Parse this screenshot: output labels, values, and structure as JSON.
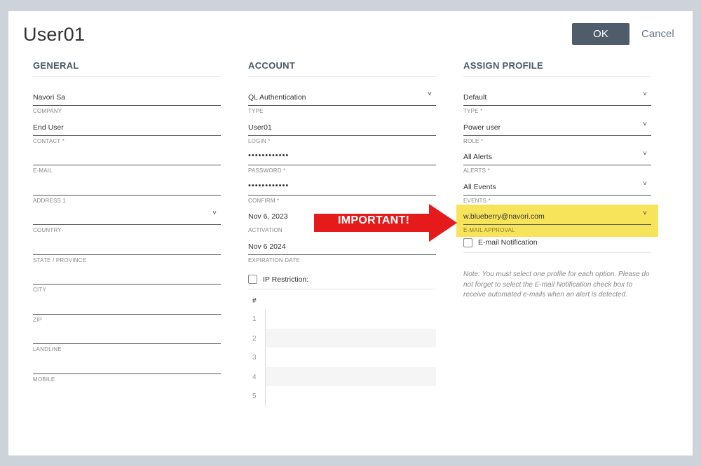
{
  "dialog": {
    "title": "User01",
    "ok_label": "OK",
    "cancel_label": "Cancel"
  },
  "general": {
    "heading": "GENERAL",
    "fields": [
      {
        "value": "Navori Sa",
        "label": "COMPANY"
      },
      {
        "value": "End User",
        "label": "CONTACT *"
      },
      {
        "value": "",
        "label": "E-MAIL"
      },
      {
        "value": "",
        "label": "ADDRESS 1"
      },
      {
        "value": "",
        "label": "COUNTRY"
      },
      {
        "value": "",
        "label": "STATE / PROVINCE"
      },
      {
        "value": "",
        "label": "CITY"
      },
      {
        "value": "",
        "label": "ZIP"
      },
      {
        "value": "",
        "label": "LANDLINE"
      },
      {
        "value": "",
        "label": "MOBILE"
      }
    ]
  },
  "account": {
    "heading": "ACCOUNT",
    "fields": [
      {
        "value": "QL Authentication",
        "label": "TYPE"
      },
      {
        "value": "User01",
        "label": "LOGIN *"
      },
      {
        "value": "••••••••••••",
        "label": "PASSWORD *"
      },
      {
        "value": "••••••••••••",
        "label": "CONFIRM *"
      },
      {
        "value": "Nov 6, 2023",
        "label": "ACTIVATION"
      },
      {
        "value": "Nov 6 2024",
        "label": "EXPIRATION DATE"
      }
    ],
    "ip_restriction_label": "IP Restriction:",
    "ip_table": {
      "header": "#",
      "rows": [
        "1",
        "2",
        "3",
        "4",
        "5"
      ]
    }
  },
  "profile": {
    "heading": "ASSIGN PROFILE",
    "fields": [
      {
        "value": "Default",
        "label": "TYPE *"
      },
      {
        "value": "Power user",
        "label": "ROLE *"
      },
      {
        "value": "All Alerts",
        "label": "ALERTS *"
      },
      {
        "value": "All Events",
        "label": "EVENTS *"
      },
      {
        "value": "w.blueberry@navori.com",
        "label": "E-MAIL APPROVAL"
      }
    ],
    "email_notification_label": "E-mail Notification",
    "note": "Note: You must select one profile for each option. Please do not forget to select the E-mail Notification check box to receive automated e-mails when an alert is detected."
  },
  "annotation": {
    "text": "IMPORTANT!",
    "arrow_color": "#e51b1b",
    "highlight_color": "#f8e45a"
  },
  "chevron_glyph": "˅",
  "colors": {
    "ok_button": "#4f5d6b",
    "backdrop": "#cdd3da"
  }
}
